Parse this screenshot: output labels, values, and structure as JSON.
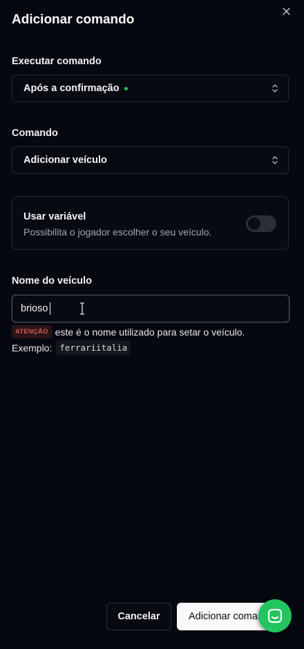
{
  "dialog": {
    "title": "Adicionar comando",
    "close_icon": "close-icon"
  },
  "execute": {
    "label": "Executar comando",
    "value": "Após a confirmação",
    "status_color": "#22c55e"
  },
  "command": {
    "label": "Comando",
    "value": "Adicionar veículo"
  },
  "variable": {
    "title": "Usar variável",
    "description": "Possibilita o jogador escolher o seu veículo.",
    "enabled": false
  },
  "vehicle_name": {
    "label": "Nome do veículo",
    "value": "brioso",
    "badge": "ATENÇÃO",
    "hint": "este é o nome utilizado para setar o veículo.",
    "example_label": "Exemplo:",
    "example_value": "ferrariitalia"
  },
  "footer": {
    "cancel_label": "Cancelar",
    "submit_label": "Adicionar comando"
  },
  "chat": {
    "icon": "chat-icon",
    "color": "#22c55e"
  }
}
